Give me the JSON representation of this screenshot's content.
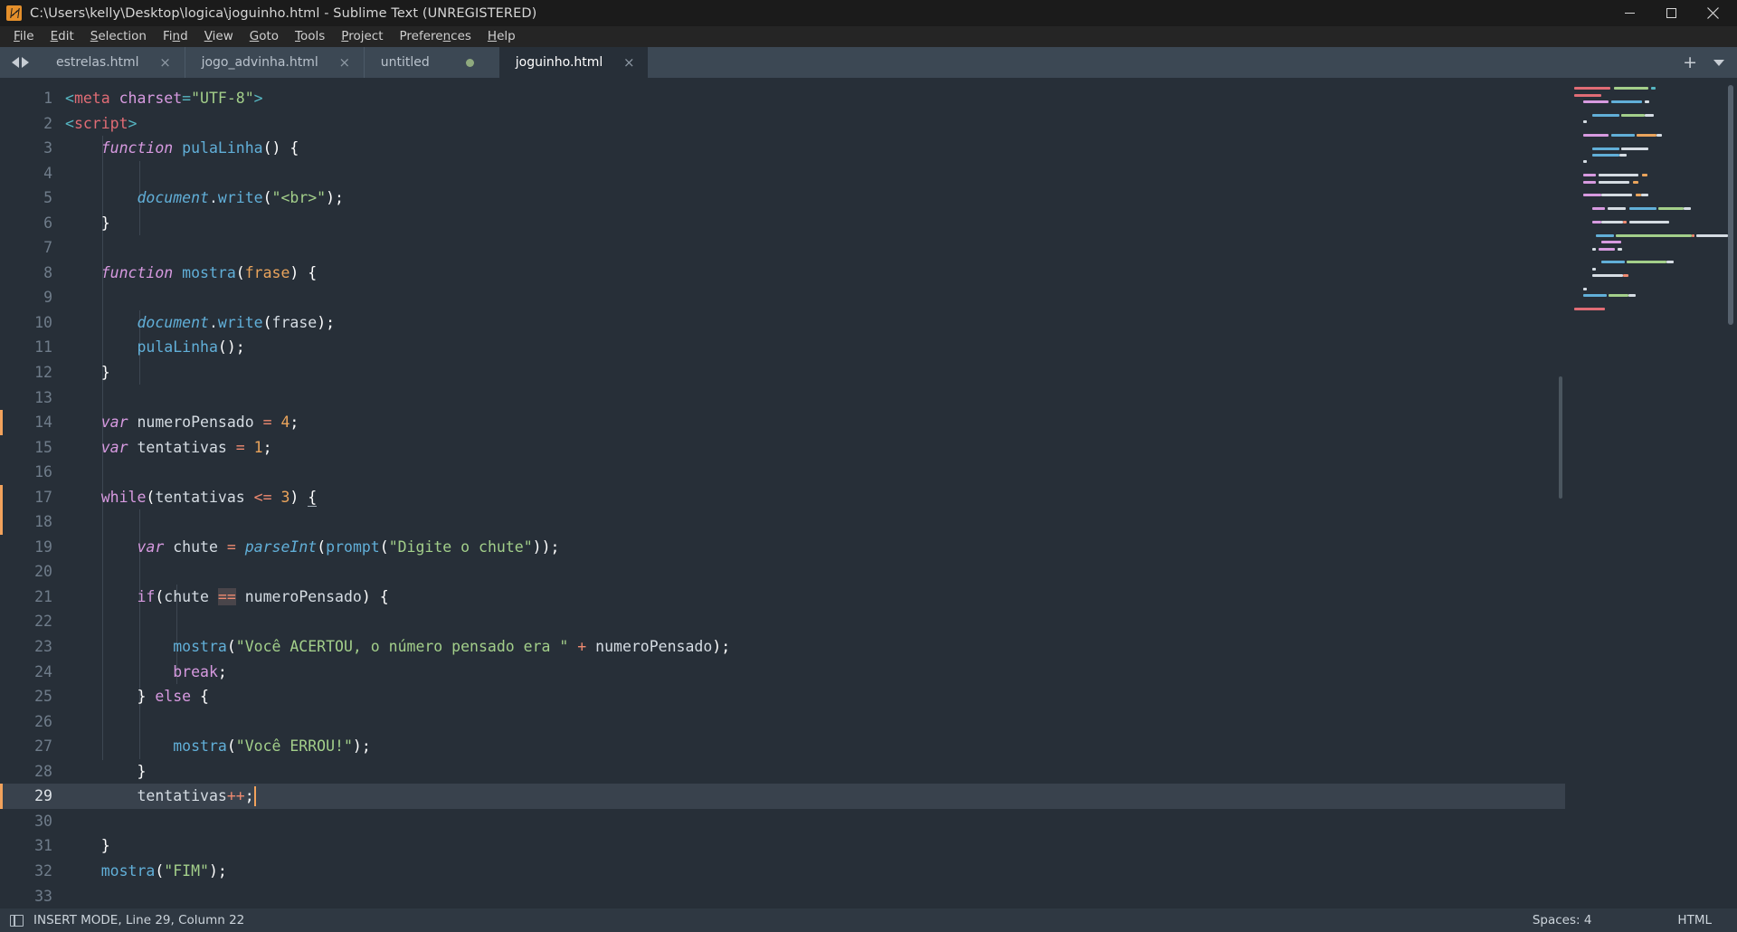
{
  "window": {
    "title": "C:\\Users\\kelly\\Desktop\\logica\\joguinho.html - Sublime Text (UNREGISTERED)",
    "logo_name": "sublime-text-logo",
    "minimize_label": "Minimize",
    "maximize_label": "Maximize",
    "close_label": "Close"
  },
  "menubar": {
    "items": [
      {
        "label": "File",
        "mnemonic": "F"
      },
      {
        "label": "Edit",
        "mnemonic": "E"
      },
      {
        "label": "Selection",
        "mnemonic": "S"
      },
      {
        "label": "Find",
        "mnemonic": "n"
      },
      {
        "label": "View",
        "mnemonic": "V"
      },
      {
        "label": "Goto",
        "mnemonic": "G"
      },
      {
        "label": "Tools",
        "mnemonic": "T"
      },
      {
        "label": "Project",
        "mnemonic": "P"
      },
      {
        "label": "Preferences",
        "mnemonic": "n"
      },
      {
        "label": "Help",
        "mnemonic": "H"
      }
    ]
  },
  "tabbar": {
    "prev_label": "◀",
    "next_label": "▶",
    "new_tab_label": "+",
    "tabs": [
      {
        "label": "estrelas.html",
        "active": false,
        "dirty": false,
        "close_label": "×"
      },
      {
        "label": "jogo_advinha.html",
        "active": false,
        "dirty": false,
        "close_label": "×"
      },
      {
        "label": "untitled",
        "active": false,
        "dirty": true,
        "close_label": "×"
      },
      {
        "label": "joguinho.html",
        "active": true,
        "dirty": false,
        "close_label": "×"
      }
    ]
  },
  "editor": {
    "line_numbers": [
      "1",
      "2",
      "3",
      "4",
      "5",
      "6",
      "7",
      "8",
      "9",
      "10",
      "11",
      "12",
      "13",
      "14",
      "15",
      "16",
      "17",
      "18",
      "19",
      "20",
      "21",
      "22",
      "23",
      "24",
      "25",
      "26",
      "27",
      "28",
      "29",
      "30",
      "31",
      "32",
      "33"
    ],
    "current_line": 29,
    "marked_lines": [
      14,
      17,
      18,
      29
    ],
    "lines": [
      "<meta charset=\"UTF-8\">",
      "<script>",
      "    function pulaLinha() {",
      "",
      "        document.write(\"<br>\");",
      "    }",
      "",
      "    function mostra(frase) {",
      "",
      "        document.write(frase);",
      "        pulaLinha();",
      "    }",
      "",
      "    var numeroPensado = 4;",
      "    var tentativas = 1;",
      "",
      "    while(tentativas <= 3) {",
      "",
      "        var chute = parseInt(prompt(\"Digite o chute\"));",
      "",
      "        if(chute == numeroPensado) {",
      "",
      "            mostra(\"Você ACERTOU, o número pensado era \" + numeroPensado);",
      "            break;",
      "        } else {",
      "",
      "            mostra(\"Você ERROU!\");",
      "        }",
      "        tentativas++;",
      "",
      "    }",
      "    mostra(\"FIM\");",
      ""
    ]
  },
  "statusbar": {
    "sidebar_icon": "sidebar-toggle-icon",
    "left_text": "INSERT MODE, Line 29, Column 22",
    "indentation": "Spaces: 4",
    "syntax": "HTML"
  },
  "colors": {
    "editor_bg": "#272f38",
    "tabbar_bg": "#3c4854",
    "titlebar_bg": "#1b1b1b",
    "menubar_bg": "#252525",
    "statusbar_bg": "#2f3842",
    "caret": "#f2a25c",
    "accent_orange": "#e48f2b",
    "string": "#a3cf8a",
    "keyword": "#d79ae0",
    "function": "#61afd8",
    "number": "#eaa45c",
    "operator": "#ef8a70",
    "tag": "#e06c75",
    "dirty_dot": "#8faa7e"
  }
}
